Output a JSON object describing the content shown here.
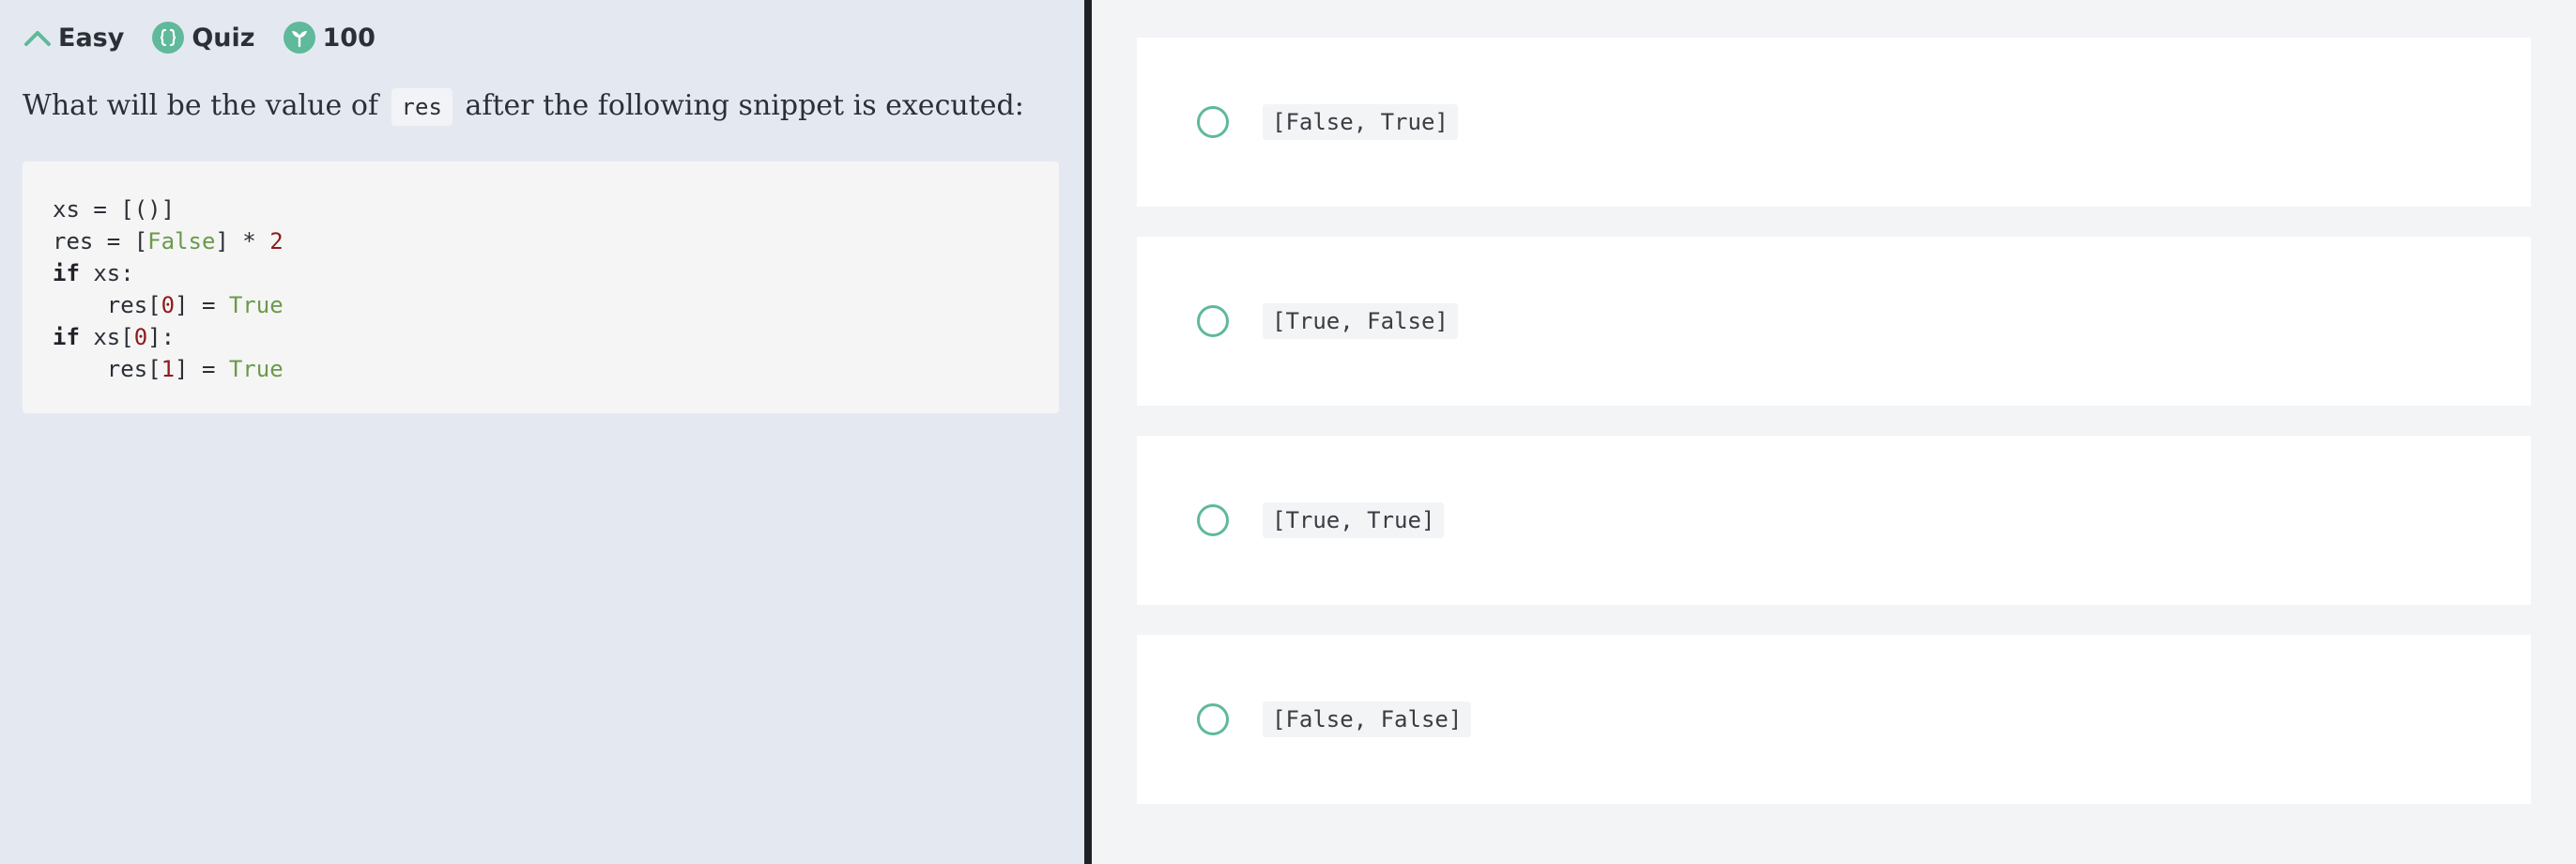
{
  "header": {
    "difficulty_label": "Easy",
    "type_label": "Quiz",
    "points_label": "100"
  },
  "question": {
    "prefix": "What will be the value of",
    "code_ref": "res",
    "suffix": "after the following snippet is executed:"
  },
  "code": {
    "lines": [
      "xs = [()]",
      "res = [False] * 2",
      "if xs:",
      "    res[0] = True",
      "if xs[0]:",
      "    res[1] = True"
    ]
  },
  "options": [
    {
      "label": "[False, True]"
    },
    {
      "label": "[True, False]"
    },
    {
      "label": "[True, True]"
    },
    {
      "label": "[False, False]"
    }
  ],
  "colors": {
    "accent": "#5fb99a",
    "left_background": "#e4e9f1",
    "right_background": "#f3f4f6",
    "divider": "#1f2126"
  }
}
